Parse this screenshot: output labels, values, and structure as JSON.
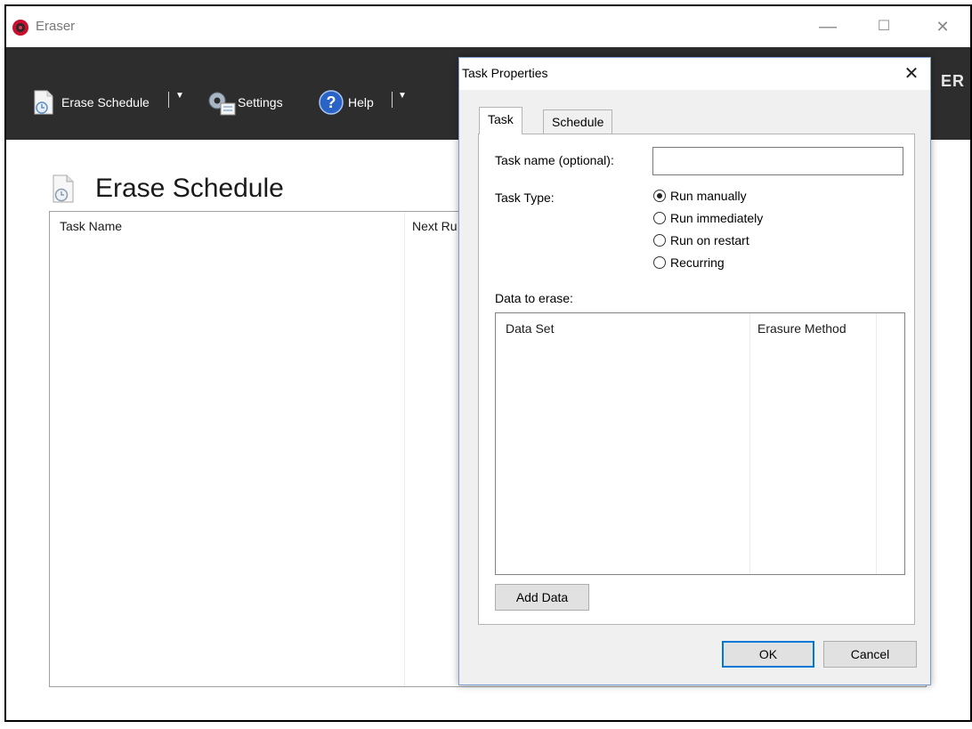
{
  "app": {
    "title": "Eraser",
    "brand_partial": "ER"
  },
  "window_controls": {
    "minimize": "—",
    "maximize": "☐",
    "close": "✕"
  },
  "toolbar": {
    "erase_schedule": "Erase Schedule",
    "settings": "Settings",
    "help": "Help",
    "dropdown_caret": "▼"
  },
  "page": {
    "title": "Erase Schedule",
    "columns": [
      "Task Name",
      "Next Ru"
    ]
  },
  "dialog": {
    "title": "Task Properties",
    "close": "✕",
    "tabs": [
      "Task",
      "Schedule"
    ],
    "task_name_label": "Task name (optional):",
    "task_name_value": "",
    "task_type_label": "Task Type:",
    "task_types": [
      {
        "label": "Run manually",
        "checked": true
      },
      {
        "label": "Run immediately",
        "checked": false
      },
      {
        "label": "Run on restart",
        "checked": false
      },
      {
        "label": "Recurring",
        "checked": false
      }
    ],
    "data_to_erase_label": "Data to erase:",
    "data_columns": [
      "Data Set",
      "Erasure Method"
    ],
    "add_data_button": "Add Data",
    "ok_button": "OK",
    "cancel_button": "Cancel"
  },
  "colors": {
    "toolbar_bg": "#2d2d2d",
    "app_icon": "#c8102e",
    "dialog_border": "#7a9ccf",
    "ok_focus": "#0078d7"
  }
}
